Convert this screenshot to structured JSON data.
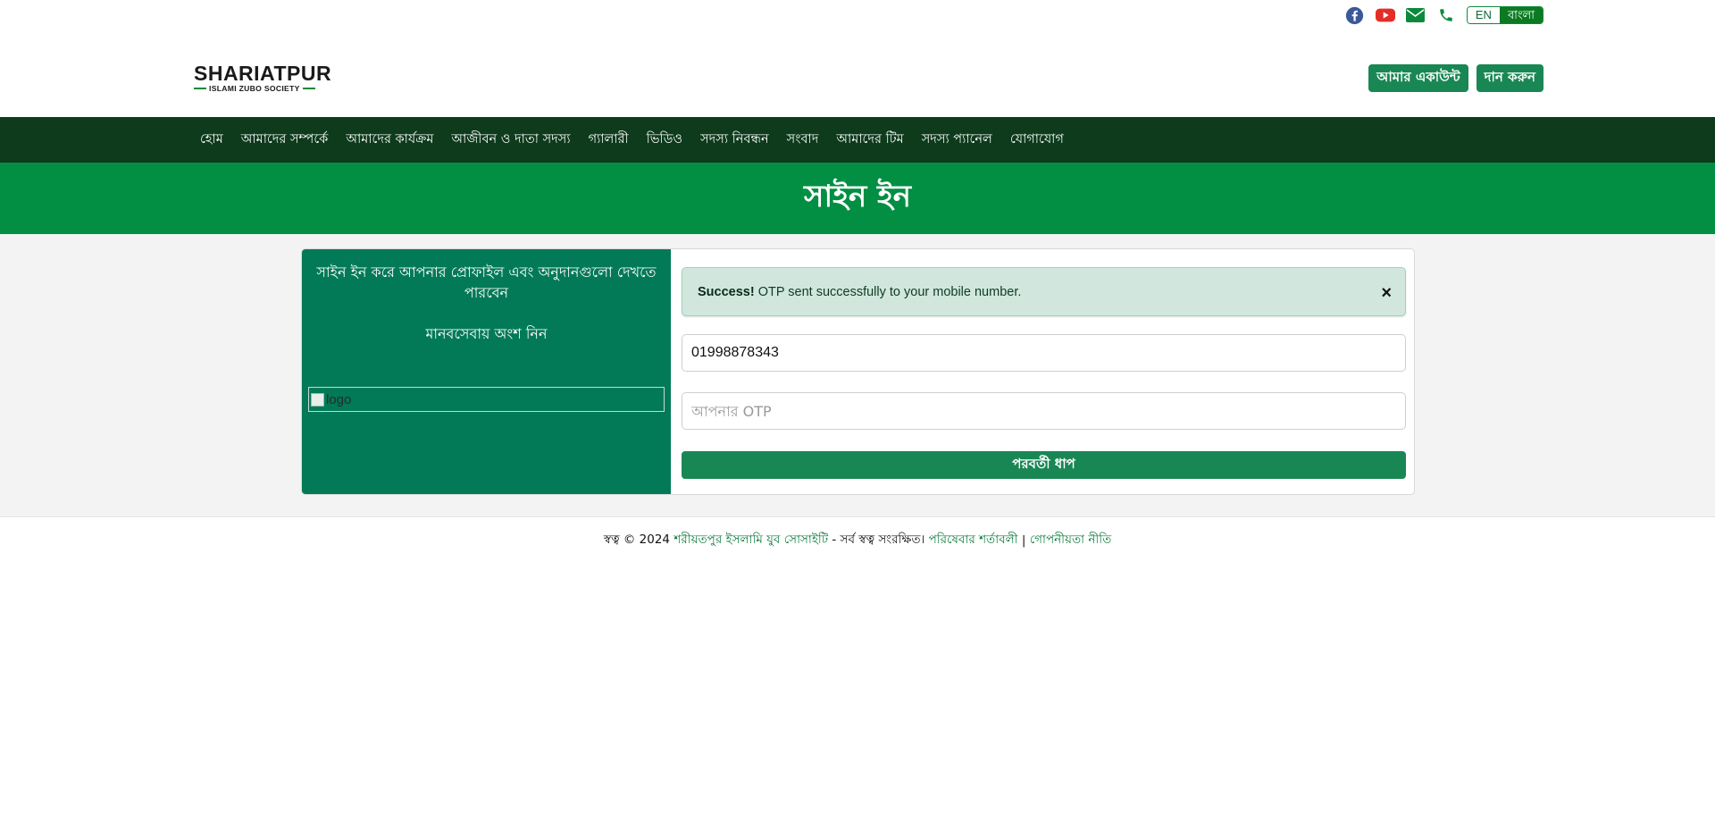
{
  "topbar": {
    "icons": [
      "facebook-icon",
      "youtube-icon",
      "envelope-icon",
      "phone-icon"
    ],
    "lang_en": "EN",
    "lang_bn": "বাংলা"
  },
  "header": {
    "logo_line1": "SHARIATPUR",
    "logo_line2": "ISLAMI ZUBO SOCIETY",
    "account_button": "আমার একাউন্ট",
    "donate_button": "দান করুন"
  },
  "nav": {
    "items": [
      "হোম",
      "আমাদের সম্পর্কে",
      "আমাদের কার্যক্রম",
      "আজীবন ও দাতা সদস্য",
      "গ্যালারী",
      "ভিডিও",
      "সদস্য নিবন্ধন",
      "সংবাদ",
      "আমাদের টিম",
      "সদস্য প্যানেল",
      "যোগাযোগ"
    ]
  },
  "banner": {
    "title": "সাইন ইন"
  },
  "signin": {
    "left_text1": "সাইন ইন করে আপনার প্রোফাইল এবং অনুদানগুলো দেখতে পারবেন",
    "left_text2": "মানবসেবায় অংশ নিন",
    "logo_alt": "logo",
    "alert_strong": "Success!",
    "alert_text": "OTP sent successfully to your mobile number.",
    "alert_close": "×",
    "phone_value": "01998878343",
    "otp_placeholder": "আপনার OTP",
    "submit_label": "পরবর্তী ধাপ"
  },
  "footer": {
    "prefix": "স্বত্ব © 2024",
    "org_link": "শরীয়তপুর ইসলামি যুব সোসাইটি",
    "rights": "- সর্ব স্বত্ব সংরক্ষিত।",
    "terms_link": "পরিষেবার শর্তাবলী",
    "separator": "|",
    "privacy_link": "গোপনীয়তা নীতি"
  },
  "colors": {
    "nav_bg": "#0d3b1c",
    "banner_bg": "#028f43",
    "card_left_bg": "#027a57",
    "button_green": "#198754",
    "alert_bg": "#d1e7dd"
  }
}
